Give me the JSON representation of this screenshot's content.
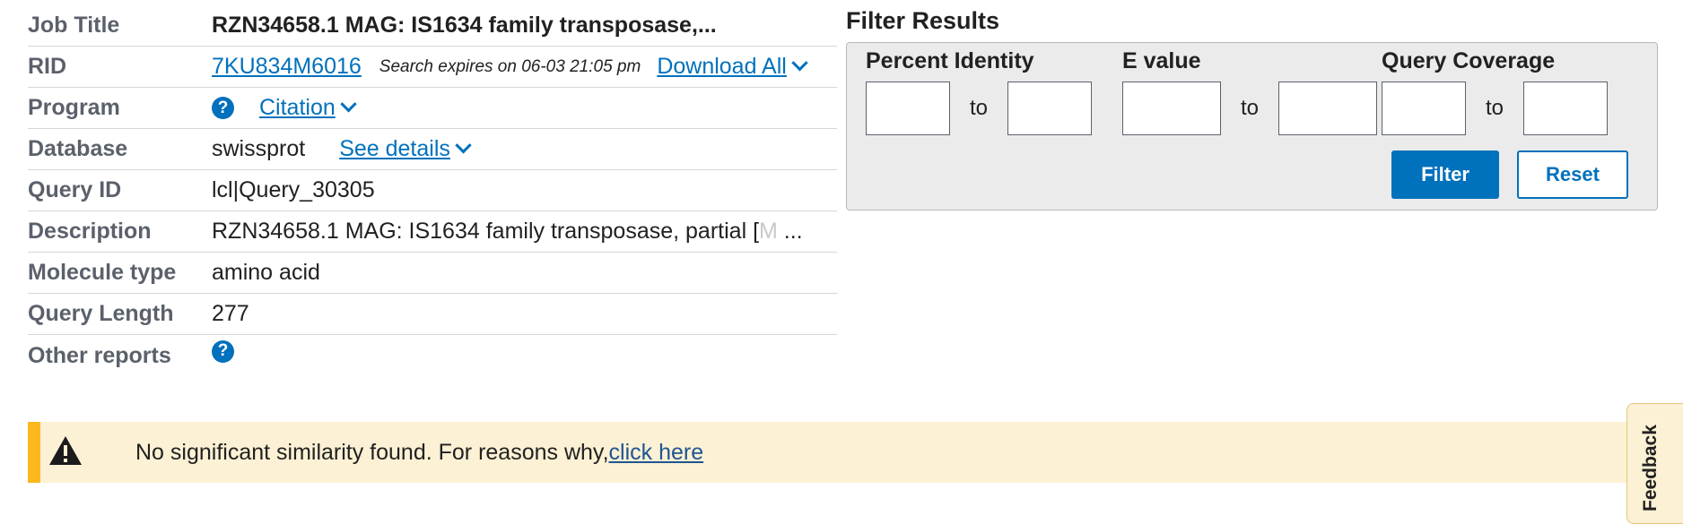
{
  "info": {
    "job_title_label": "Job Title",
    "job_title_value": "RZN34658.1 MAG: IS1634 family transposase,...",
    "rid_label": "RID",
    "rid_value": "7KU834M6016",
    "rid_expires": "Search expires on 06-03 21:05 pm",
    "download_all": "Download All",
    "program_label": "Program",
    "citation": "Citation",
    "database_label": "Database",
    "database_value": "swissprot",
    "see_details": "See details",
    "query_id_label": "Query ID",
    "query_id_value": "lcl|Query_30305",
    "description_label": "Description",
    "description_value": "RZN34658.1 MAG: IS1634 family transposase, partial [",
    "description_fade": "M",
    "description_ellipsis": " ...",
    "molecule_type_label": "Molecule type",
    "molecule_type_value": "amino acid",
    "query_length_label": "Query Length",
    "query_length_value": "277",
    "other_reports_label": "Other reports",
    "help_glyph": "?"
  },
  "filter": {
    "title": "Filter Results",
    "percent_identity_label": "Percent Identity",
    "e_value_label": "E value",
    "query_coverage_label": "Query Coverage",
    "to_label": "to",
    "filter_button": "Filter",
    "reset_button": "Reset"
  },
  "alert": {
    "message": "No significant similarity found. For reasons why,",
    "link": "click here"
  },
  "feedback": {
    "label": "Feedback"
  },
  "colors": {
    "link_blue": "#0071bc",
    "alert_bg": "#fcf1d4",
    "alert_accent": "#fdb81e",
    "panel_bg": "#ebebeb"
  }
}
